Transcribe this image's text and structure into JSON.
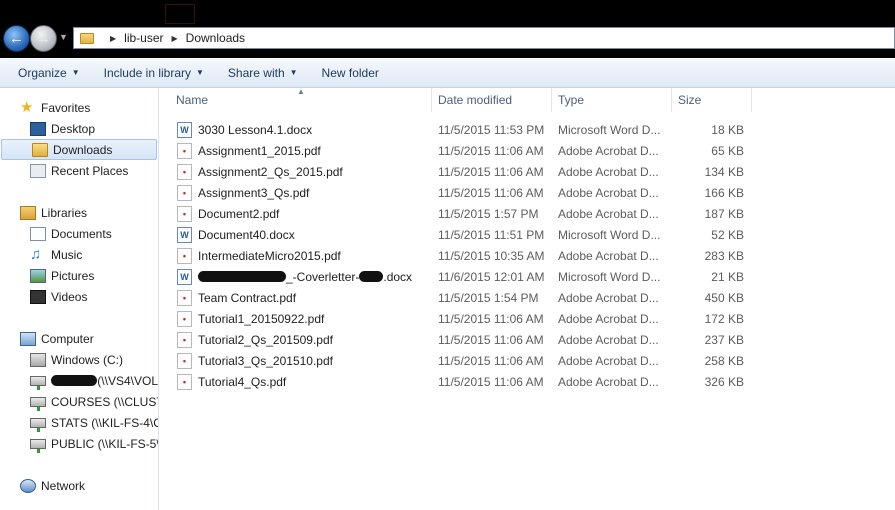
{
  "window": {
    "nav": {
      "back_icon": "back-arrow-icon",
      "forward_icon": "forward-arrow-icon"
    },
    "breadcrumb": [
      "lib-user",
      "Downloads"
    ]
  },
  "toolbar": {
    "organize": "Organize",
    "include_in_library": "Include in library",
    "share_with": "Share with",
    "new_folder": "New folder"
  },
  "sidebar": {
    "favorites": {
      "label": "Favorites",
      "items": [
        "Desktop",
        "Downloads",
        "Recent Places"
      ],
      "selected": "Downloads"
    },
    "libraries": {
      "label": "Libraries",
      "items": [
        "Documents",
        "Music",
        "Pictures",
        "Videos"
      ]
    },
    "computer": {
      "label": "Computer",
      "items": [
        {
          "label": "Windows  (C:)"
        },
        {
          "label_suffix": "(\\\\VS4\\VOL"
        },
        {
          "label": "COURSES (\\\\CLUSTE"
        },
        {
          "label": "STATS (\\\\KIL-FS-4\\C"
        },
        {
          "label": "PUBLIC (\\\\KIL-FS-5\\"
        }
      ]
    },
    "network": {
      "label": "Network"
    }
  },
  "columns": {
    "name": "Name",
    "date": "Date modified",
    "type": "Type",
    "size": "Size"
  },
  "files": [
    {
      "name": "3030 Lesson4.1.docx",
      "date": "11/5/2015 11:53 PM",
      "type": "Microsoft Word D...",
      "size": "18 KB",
      "kind": "word"
    },
    {
      "name": "Assignment1_2015.pdf",
      "date": "11/5/2015 11:06 AM",
      "type": "Adobe Acrobat D...",
      "size": "65 KB",
      "kind": "pdf"
    },
    {
      "name": "Assignment2_Qs_2015.pdf",
      "date": "11/5/2015 11:06 AM",
      "type": "Adobe Acrobat D...",
      "size": "134 KB",
      "kind": "pdf"
    },
    {
      "name": "Assignment3_Qs.pdf",
      "date": "11/5/2015 11:06 AM",
      "type": "Adobe Acrobat D...",
      "size": "166 KB",
      "kind": "pdf"
    },
    {
      "name": "Document2.pdf",
      "date": "11/5/2015 1:57 PM",
      "type": "Adobe Acrobat D...",
      "size": "187 KB",
      "kind": "pdf"
    },
    {
      "name": "Document40.docx",
      "date": "11/5/2015 11:51 PM",
      "type": "Microsoft Word D...",
      "size": "52 KB",
      "kind": "word"
    },
    {
      "name": "IntermediateMicro2015.pdf",
      "date": "11/5/2015 10:35 AM",
      "type": "Adobe Acrobat D...",
      "size": "283 KB",
      "kind": "pdf"
    },
    {
      "name_mid": "_-Coverletter-",
      "name_end": ".docx",
      "date": "11/6/2015 12:01 AM",
      "type": "Microsoft Word D...",
      "size": "21 KB",
      "kind": "word",
      "redacted": true
    },
    {
      "name": "Team Contract.pdf",
      "date": "11/5/2015 1:54 PM",
      "type": "Adobe Acrobat D...",
      "size": "450 KB",
      "kind": "pdf"
    },
    {
      "name": "Tutorial1_20150922.pdf",
      "date": "11/5/2015 11:06 AM",
      "type": "Adobe Acrobat D...",
      "size": "172 KB",
      "kind": "pdf"
    },
    {
      "name": "Tutorial2_Qs_201509.pdf",
      "date": "11/5/2015 11:06 AM",
      "type": "Adobe Acrobat D...",
      "size": "237 KB",
      "kind": "pdf"
    },
    {
      "name": "Tutorial3_Qs_201510.pdf",
      "date": "11/5/2015 11:06 AM",
      "type": "Adobe Acrobat D...",
      "size": "258 KB",
      "kind": "pdf"
    },
    {
      "name": "Tutorial4_Qs.pdf",
      "date": "11/5/2015 11:06 AM",
      "type": "Adobe Acrobat D...",
      "size": "326 KB",
      "kind": "pdf"
    }
  ]
}
